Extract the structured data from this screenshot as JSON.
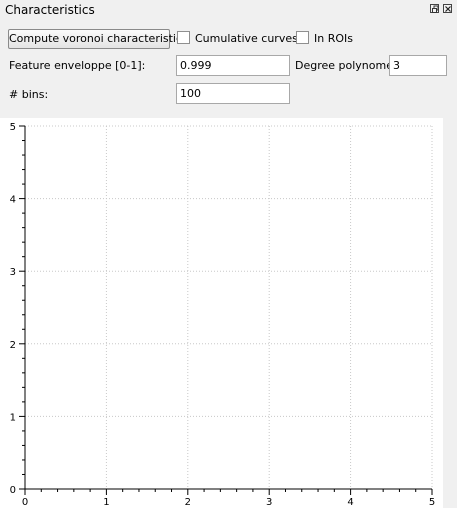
{
  "window": {
    "title": "Characteristics"
  },
  "controls": {
    "compute_button": "Compute voronoi characteristics",
    "cumulative_label": "Cumulative curves",
    "cumulative_checked": false,
    "rois_label": "In ROIs",
    "rois_checked": false,
    "feature_label": "Feature enveloppe [0-1]:",
    "feature_value": "0.999",
    "degree_label": "Degree polynome:",
    "degree_value": "3",
    "bins_label": "# bins:",
    "bins_value": "100"
  },
  "chart_data": {
    "type": "line",
    "series": [],
    "xlim": [
      0,
      5
    ],
    "ylim": [
      0,
      5
    ],
    "xticks": [
      "0",
      "1",
      "2",
      "3",
      "4",
      "5"
    ],
    "yticks": [
      "0",
      "1",
      "2",
      "3",
      "4",
      "5"
    ],
    "grid": true,
    "grid_style": "dotted",
    "axis_color": "#000000",
    "grid_color": "#c8c8c8",
    "background": "#ffffff"
  }
}
